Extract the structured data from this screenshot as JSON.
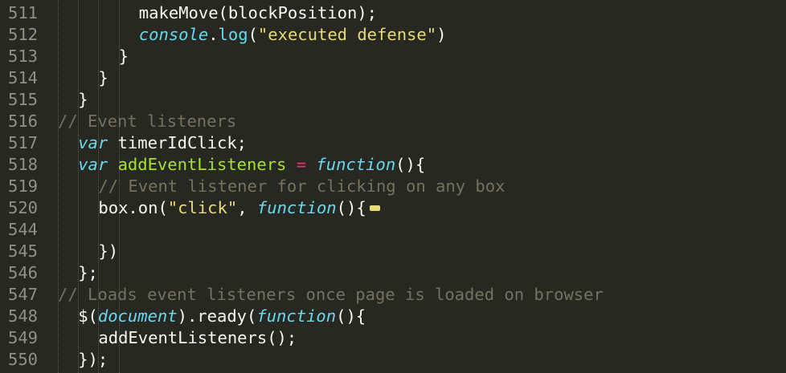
{
  "colors": {
    "background": "#272822",
    "line_number": "#90908a",
    "plain": "#f8f8f2",
    "comment": "#75715e",
    "string": "#e6db74",
    "keyword": "#66d9ef",
    "function_name": "#a6e22e",
    "operator": "#f92672"
  },
  "lines": [
    {
      "num": "511",
      "indent": 4,
      "tokens": [
        {
          "t": "makeMove(blockPosition);",
          "c": "plain"
        }
      ]
    },
    {
      "num": "512",
      "indent": 4,
      "tokens": [
        {
          "t": "console",
          "c": "italicblue"
        },
        {
          "t": ".",
          "c": "plain"
        },
        {
          "t": "log",
          "c": "builtin"
        },
        {
          "t": "(",
          "c": "plain"
        },
        {
          "t": "\"executed defense\"",
          "c": "string"
        },
        {
          "t": ")",
          "c": "plain"
        }
      ]
    },
    {
      "num": "513",
      "indent": 3,
      "tokens": [
        {
          "t": "}",
          "c": "plain"
        }
      ]
    },
    {
      "num": "514",
      "indent": 2,
      "tokens": [
        {
          "t": "}",
          "c": "plain"
        }
      ]
    },
    {
      "num": "515",
      "indent": 1,
      "tokens": [
        {
          "t": "}",
          "c": "plain"
        }
      ]
    },
    {
      "num": "516",
      "indent": 0,
      "tokens": [
        {
          "t": "// Event listeners",
          "c": "comment"
        }
      ]
    },
    {
      "num": "517",
      "indent": 1,
      "tokens": [
        {
          "t": "var",
          "c": "keyword"
        },
        {
          "t": " timerIdClick;",
          "c": "plain"
        }
      ]
    },
    {
      "num": "518",
      "indent": 1,
      "tokens": [
        {
          "t": "var",
          "c": "keyword"
        },
        {
          "t": " ",
          "c": "plain"
        },
        {
          "t": "addEventListeners",
          "c": "func"
        },
        {
          "t": " ",
          "c": "plain"
        },
        {
          "t": "=",
          "c": "op"
        },
        {
          "t": " ",
          "c": "plain"
        },
        {
          "t": "function",
          "c": "keyword"
        },
        {
          "t": "(){",
          "c": "plain"
        }
      ]
    },
    {
      "num": "519",
      "indent": 2,
      "tokens": [
        {
          "t": "// Event listener for clicking on any box",
          "c": "comment"
        }
      ]
    },
    {
      "num": "520",
      "indent": 2,
      "tokens": [
        {
          "t": "box.on(",
          "c": "plain"
        },
        {
          "t": "\"click\"",
          "c": "string"
        },
        {
          "t": ", ",
          "c": "plain"
        },
        {
          "t": "function",
          "c": "keyword"
        },
        {
          "t": "(){",
          "c": "plain"
        }
      ],
      "fold": true
    },
    {
      "num": "544",
      "indent": 0,
      "tokens": []
    },
    {
      "num": "545",
      "indent": 2,
      "tokens": [
        {
          "t": "})",
          "c": "plain"
        }
      ]
    },
    {
      "num": "546",
      "indent": 1,
      "tokens": [
        {
          "t": "};",
          "c": "plain"
        }
      ]
    },
    {
      "num": "547",
      "indent": 0,
      "tokens": [
        {
          "t": "// Loads event listeners once page is loaded on browser",
          "c": "comment"
        }
      ]
    },
    {
      "num": "548",
      "indent": 1,
      "tokens": [
        {
          "t": "$(",
          "c": "plain"
        },
        {
          "t": "document",
          "c": "italicblue"
        },
        {
          "t": ").ready(",
          "c": "plain"
        },
        {
          "t": "function",
          "c": "keyword"
        },
        {
          "t": "(){",
          "c": "plain"
        }
      ]
    },
    {
      "num": "549",
      "indent": 2,
      "tokens": [
        {
          "t": "addEventListeners();",
          "c": "plain"
        }
      ]
    },
    {
      "num": "550",
      "indent": 1,
      "tokens": [
        {
          "t": "});",
          "c": "plain"
        }
      ]
    }
  ]
}
